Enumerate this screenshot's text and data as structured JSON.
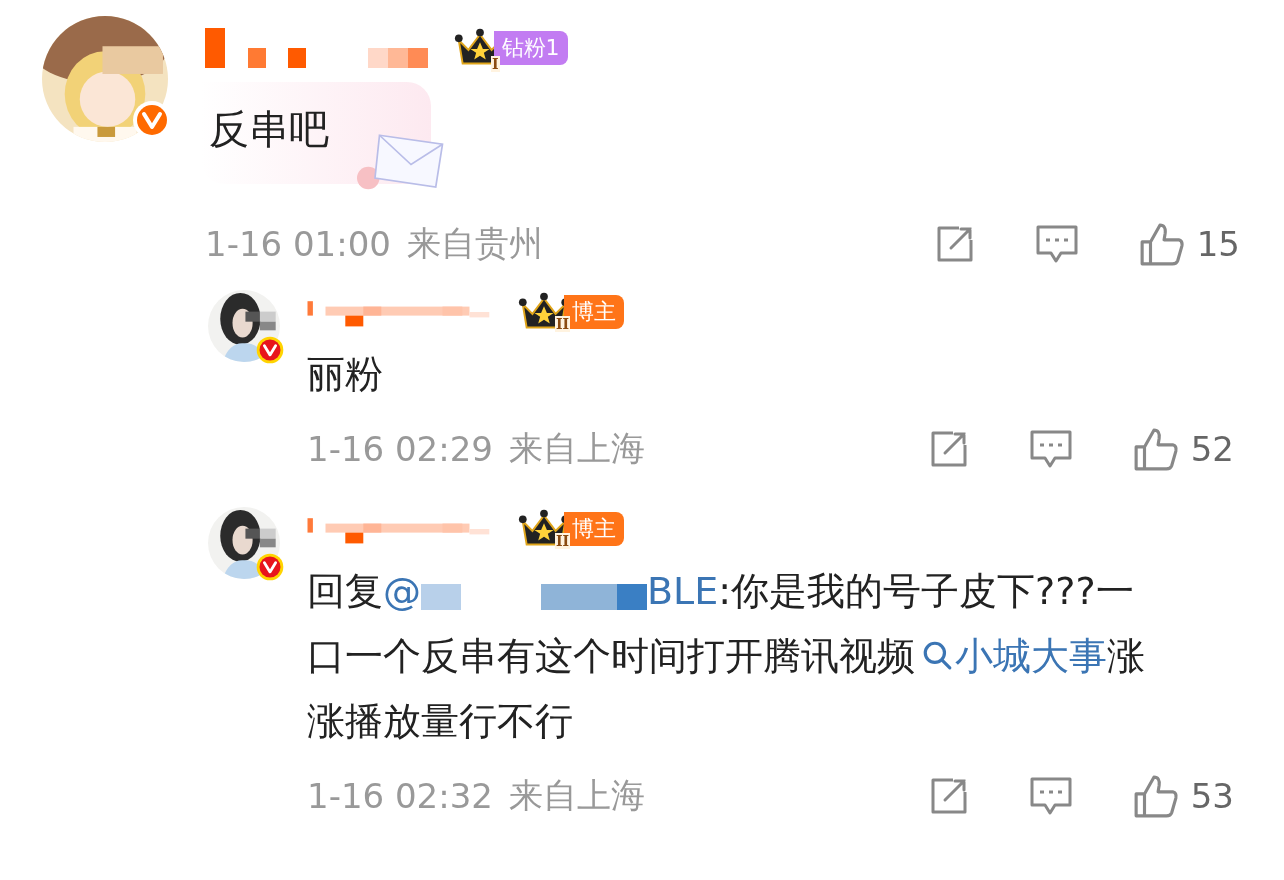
{
  "comments": [
    {
      "avatar": {
        "color": "#ff6a00"
      },
      "badge": {
        "label": "钻粉1",
        "color": "#c27cf2",
        "rank": "I"
      },
      "bubble": true,
      "body": [
        {
          "kind": "text",
          "text": "反串吧"
        }
      ],
      "time": "1-16 01:00",
      "location": "来自贵州",
      "likes": "15",
      "children": [
        {
          "avatar": {
            "color": "#e8141c"
          },
          "badge": {
            "label": "博主",
            "color": "#ff7418",
            "rank": "II"
          },
          "body": [
            {
              "kind": "text",
              "text": "丽粉"
            }
          ],
          "time": "1-16 02:29",
          "location": "来自上海",
          "likes": "52"
        },
        {
          "avatar": {
            "color": "#e8141c"
          },
          "badge": {
            "label": "博主",
            "color": "#ff7418",
            "rank": "II"
          },
          "body": [
            {
              "kind": "text",
              "text": "回复"
            },
            {
              "kind": "link",
              "text": "@"
            },
            {
              "kind": "mosaic"
            },
            {
              "kind": "link",
              "text": "BLE"
            },
            {
              "kind": "text",
              "text": ":你是我的号子皮下???一口一个反串有这个时间打开腾讯视频"
            },
            {
              "kind": "topic",
              "text": "小城大事"
            },
            {
              "kind": "text",
              "text": "涨涨播放量行不行"
            }
          ],
          "time": "1-16 02:32",
          "location": "来自上海",
          "likes": "53"
        }
      ]
    }
  ]
}
